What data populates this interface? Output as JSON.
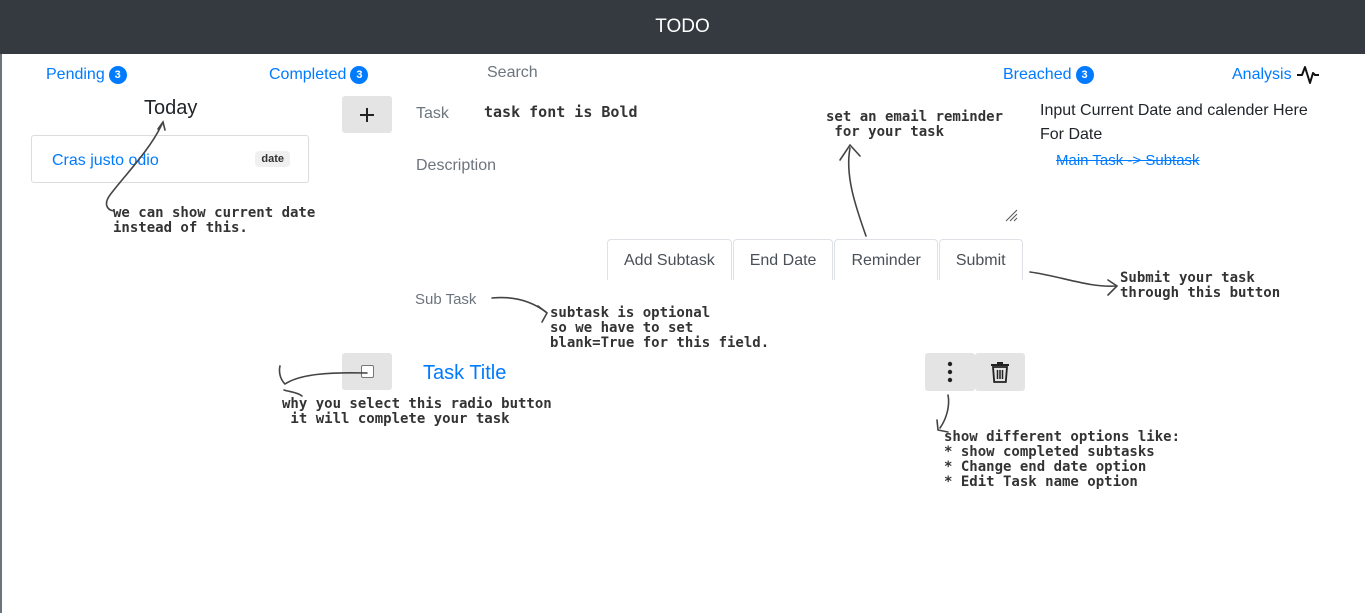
{
  "app": {
    "title": "TODO"
  },
  "nav": {
    "pending": {
      "label": "Pending",
      "count": "3"
    },
    "completed": {
      "label": "Completed",
      "count": "3"
    },
    "search": "Search",
    "breached": {
      "label": "Breached",
      "count": "3"
    },
    "analysis": "Analysis"
  },
  "today": {
    "heading": "Today",
    "card_text": "Cras justo odio",
    "card_badge": "date"
  },
  "form": {
    "task_label": "Task",
    "task_value": "task font is Bold",
    "description_label": "Description",
    "date_note_line1": "Input Current Date and calender Here",
    "date_note_line2": "For Date",
    "main_subtask_link": "Main Task -> Subtask",
    "tabs": [
      "Add Subtask",
      "End Date",
      "Reminder",
      "Submit"
    ],
    "subtask_label": "Sub Task"
  },
  "task": {
    "title": "Task Title"
  },
  "annotations": {
    "date_note": "we can show current date\ninstead of this.",
    "reminder_note": "set an email reminder\n for your task",
    "submit_note": "Submit your task\nthrough this button",
    "subtask_note": "subtask is optional\nso we have to set\nblank=True for this field.",
    "checkbox_note": "why you select this radio button\n it will complete your task",
    "options_note": "show different options like:\n* show completed subtasks\n* Change end date option\n* Edit Task name option"
  },
  "icons": [
    "plus-icon",
    "analysis-pulse-icon",
    "resize-grip-icon",
    "kebab-menu-icon",
    "trash-icon"
  ],
  "colors": {
    "navbar": "#343a40",
    "accent": "#007bff",
    "muted": "#6c757d"
  }
}
